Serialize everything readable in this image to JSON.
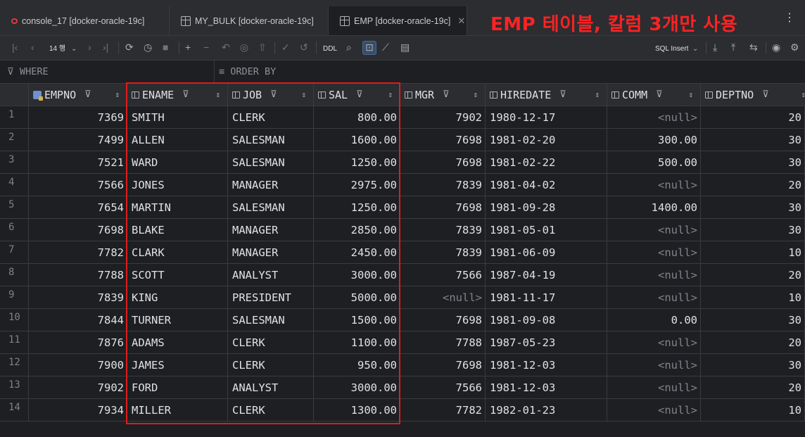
{
  "tabs": [
    {
      "label": "console_17 [docker-oracle-19c]",
      "icon": "oracle-db-icon"
    },
    {
      "label": "MY_BULK [docker-oracle-19c]",
      "icon": "table-grid-icon"
    },
    {
      "label": "EMP [docker-oracle-19c]",
      "icon": "table-grid-icon",
      "active": true
    }
  ],
  "annotation": "EMP 테이블, 칼럼 3개만 사용",
  "toolbar": {
    "page_size": "14 행",
    "ddl_label": "DDL",
    "mode_label": "SQL Insert"
  },
  "filter": {
    "where_label": "WHERE",
    "order_label": "ORDER BY"
  },
  "columns": [
    "EMPNO",
    "ENAME",
    "JOB",
    "SAL",
    "MGR",
    "HIREDATE",
    "COMM",
    "DEPTNO"
  ],
  "rows": [
    {
      "n": "1",
      "empno": "7369",
      "ename": "SMITH",
      "job": "CLERK",
      "sal": "800.00",
      "mgr": "7902",
      "hiredate": "1980-12-17",
      "comm": "<null>",
      "deptno": "20"
    },
    {
      "n": "2",
      "empno": "7499",
      "ename": "ALLEN",
      "job": "SALESMAN",
      "sal": "1600.00",
      "mgr": "7698",
      "hiredate": "1981-02-20",
      "comm": "300.00",
      "deptno": "30"
    },
    {
      "n": "3",
      "empno": "7521",
      "ename": "WARD",
      "job": "SALESMAN",
      "sal": "1250.00",
      "mgr": "7698",
      "hiredate": "1981-02-22",
      "comm": "500.00",
      "deptno": "30"
    },
    {
      "n": "4",
      "empno": "7566",
      "ename": "JONES",
      "job": "MANAGER",
      "sal": "2975.00",
      "mgr": "7839",
      "hiredate": "1981-04-02",
      "comm": "<null>",
      "deptno": "20"
    },
    {
      "n": "5",
      "empno": "7654",
      "ename": "MARTIN",
      "job": "SALESMAN",
      "sal": "1250.00",
      "mgr": "7698",
      "hiredate": "1981-09-28",
      "comm": "1400.00",
      "deptno": "30"
    },
    {
      "n": "6",
      "empno": "7698",
      "ename": "BLAKE",
      "job": "MANAGER",
      "sal": "2850.00",
      "mgr": "7839",
      "hiredate": "1981-05-01",
      "comm": "<null>",
      "deptno": "30"
    },
    {
      "n": "7",
      "empno": "7782",
      "ename": "CLARK",
      "job": "MANAGER",
      "sal": "2450.00",
      "mgr": "7839",
      "hiredate": "1981-06-09",
      "comm": "<null>",
      "deptno": "10"
    },
    {
      "n": "8",
      "empno": "7788",
      "ename": "SCOTT",
      "job": "ANALYST",
      "sal": "3000.00",
      "mgr": "7566",
      "hiredate": "1987-04-19",
      "comm": "<null>",
      "deptno": "20"
    },
    {
      "n": "9",
      "empno": "7839",
      "ename": "KING",
      "job": "PRESIDENT",
      "sal": "5000.00",
      "mgr": "<null>",
      "hiredate": "1981-11-17",
      "comm": "<null>",
      "deptno": "10"
    },
    {
      "n": "10",
      "empno": "7844",
      "ename": "TURNER",
      "job": "SALESMAN",
      "sal": "1500.00",
      "mgr": "7698",
      "hiredate": "1981-09-08",
      "comm": "0.00",
      "deptno": "30"
    },
    {
      "n": "11",
      "empno": "7876",
      "ename": "ADAMS",
      "job": "CLERK",
      "sal": "1100.00",
      "mgr": "7788",
      "hiredate": "1987-05-23",
      "comm": "<null>",
      "deptno": "20"
    },
    {
      "n": "12",
      "empno": "7900",
      "ename": "JAMES",
      "job": "CLERK",
      "sal": "950.00",
      "mgr": "7698",
      "hiredate": "1981-12-03",
      "comm": "<null>",
      "deptno": "30"
    },
    {
      "n": "13",
      "empno": "7902",
      "ename": "FORD",
      "job": "ANALYST",
      "sal": "3000.00",
      "mgr": "7566",
      "hiredate": "1981-12-03",
      "comm": "<null>",
      "deptno": "20"
    },
    {
      "n": "14",
      "empno": "7934",
      "ename": "MILLER",
      "job": "CLERK",
      "sal": "1300.00",
      "mgr": "7782",
      "hiredate": "1982-01-23",
      "comm": "<null>",
      "deptno": "10"
    }
  ],
  "colors": {
    "annotation": "#ff2222",
    "highlight_box": "#e01c1c",
    "background": "#1e1f22"
  }
}
